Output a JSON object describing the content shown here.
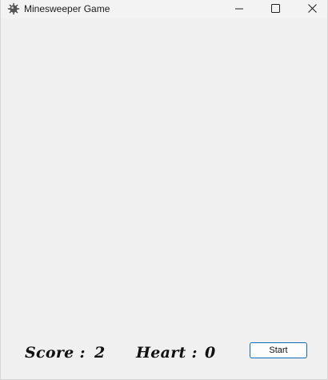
{
  "window": {
    "title": "Minesweeper Game",
    "icon": "mine-icon",
    "controls": {
      "minimize_icon": "minimize-icon",
      "maximize_icon": "maximize-icon",
      "close_icon": "close-icon"
    }
  },
  "status_bar": {
    "score_label": "Score :",
    "score_value": "2",
    "heart_label": "Heart :",
    "heart_value": "0",
    "start_label": "Start"
  },
  "colors": {
    "background": "#f0f0f0",
    "titlebar": "#f3f3f3",
    "button_border": "#0f6cbd"
  }
}
